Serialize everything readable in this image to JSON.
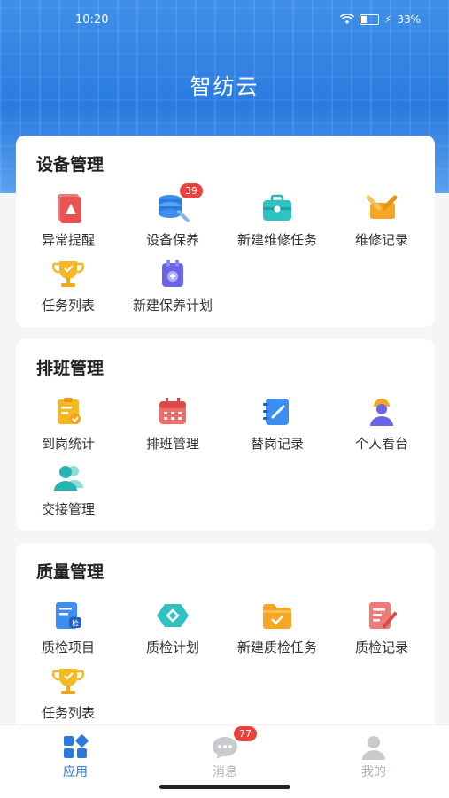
{
  "status_bar": {
    "time": "10:20",
    "battery": "33%"
  },
  "app_title": "智纺云",
  "sections": [
    {
      "title": "设备管理",
      "items": [
        {
          "label": "异常提醒",
          "icon": "alert-doc-icon"
        },
        {
          "label": "设备保养",
          "icon": "database-wrench-icon",
          "badge": "39"
        },
        {
          "label": "新建维修任务",
          "icon": "toolbox-icon"
        },
        {
          "label": "维修记录",
          "icon": "repair-record-icon"
        },
        {
          "label": "任务列表",
          "icon": "trophy-icon"
        },
        {
          "label": "新建保养计划",
          "icon": "add-plan-icon"
        }
      ]
    },
    {
      "title": "排班管理",
      "items": [
        {
          "label": "到岗统计",
          "icon": "clipboard-check-icon"
        },
        {
          "label": "排班管理",
          "icon": "calendar-icon"
        },
        {
          "label": "替岗记录",
          "icon": "notebook-pen-icon"
        },
        {
          "label": "个人看台",
          "icon": "worker-icon"
        },
        {
          "label": "交接管理",
          "icon": "users-icon"
        }
      ]
    },
    {
      "title": "质量管理",
      "items": [
        {
          "label": "质检项目",
          "icon": "inspect-doc-icon"
        },
        {
          "label": "质检计划",
          "icon": "hexagon-icon"
        },
        {
          "label": "新建质检任务",
          "icon": "folder-check-icon"
        },
        {
          "label": "质检记录",
          "icon": "edit-doc-icon"
        },
        {
          "label": "任务列表",
          "icon": "trophy-icon"
        }
      ]
    }
  ],
  "tabbar": [
    {
      "label": "应用",
      "icon": "apps-icon",
      "active": true
    },
    {
      "label": "消息",
      "icon": "message-icon",
      "badge": "77"
    },
    {
      "label": "我的",
      "icon": "profile-icon"
    }
  ],
  "colors": {
    "accent": "#2a7be0",
    "badge": "#e8423e",
    "inactive_tab": "#b0b3b8"
  }
}
